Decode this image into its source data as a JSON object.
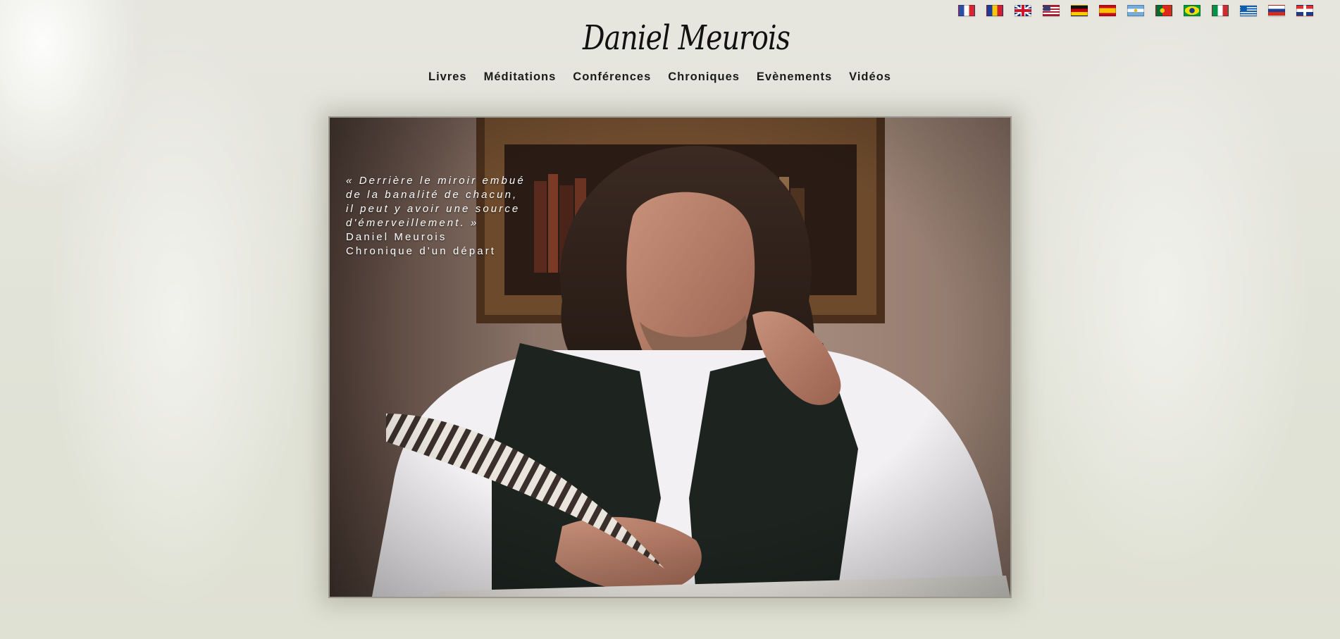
{
  "flags": [
    {
      "name": "flag-fr-icon",
      "cls": "f-fr"
    },
    {
      "name": "flag-ro-icon",
      "cls": "f-ro"
    },
    {
      "name": "flag-uk-icon",
      "cls": "f-uk"
    },
    {
      "name": "flag-us-icon",
      "cls": "f-us"
    },
    {
      "name": "flag-de-icon",
      "cls": "f-de"
    },
    {
      "name": "flag-es-icon",
      "cls": "f-es"
    },
    {
      "name": "flag-ar-icon",
      "cls": "f-ar"
    },
    {
      "name": "flag-pt-icon",
      "cls": "f-pt"
    },
    {
      "name": "flag-br-icon",
      "cls": "f-br"
    },
    {
      "name": "flag-it-icon",
      "cls": "f-it"
    },
    {
      "name": "flag-gr-icon",
      "cls": "f-gr"
    },
    {
      "name": "flag-ru-icon",
      "cls": "f-ru"
    },
    {
      "name": "flag-hr-icon",
      "cls": "f-hr"
    }
  ],
  "logo": {
    "text": "Daniel Meurois"
  },
  "nav": {
    "items": [
      "Livres",
      "Méditations",
      "Conférences",
      "Chroniques",
      "Evènements",
      "Vidéos"
    ]
  },
  "hero": {
    "quote_lines": [
      "« Derrière le miroir embué",
      "de la banalité de chacun,",
      "il peut y avoir une source",
      "d'émerveillement. »"
    ],
    "author": "Daniel Meurois",
    "source": "Chronique d'un départ"
  },
  "colors": {
    "background": "#e3e3da",
    "text": "#1a1a1a",
    "quote_text": "#ffffff"
  }
}
